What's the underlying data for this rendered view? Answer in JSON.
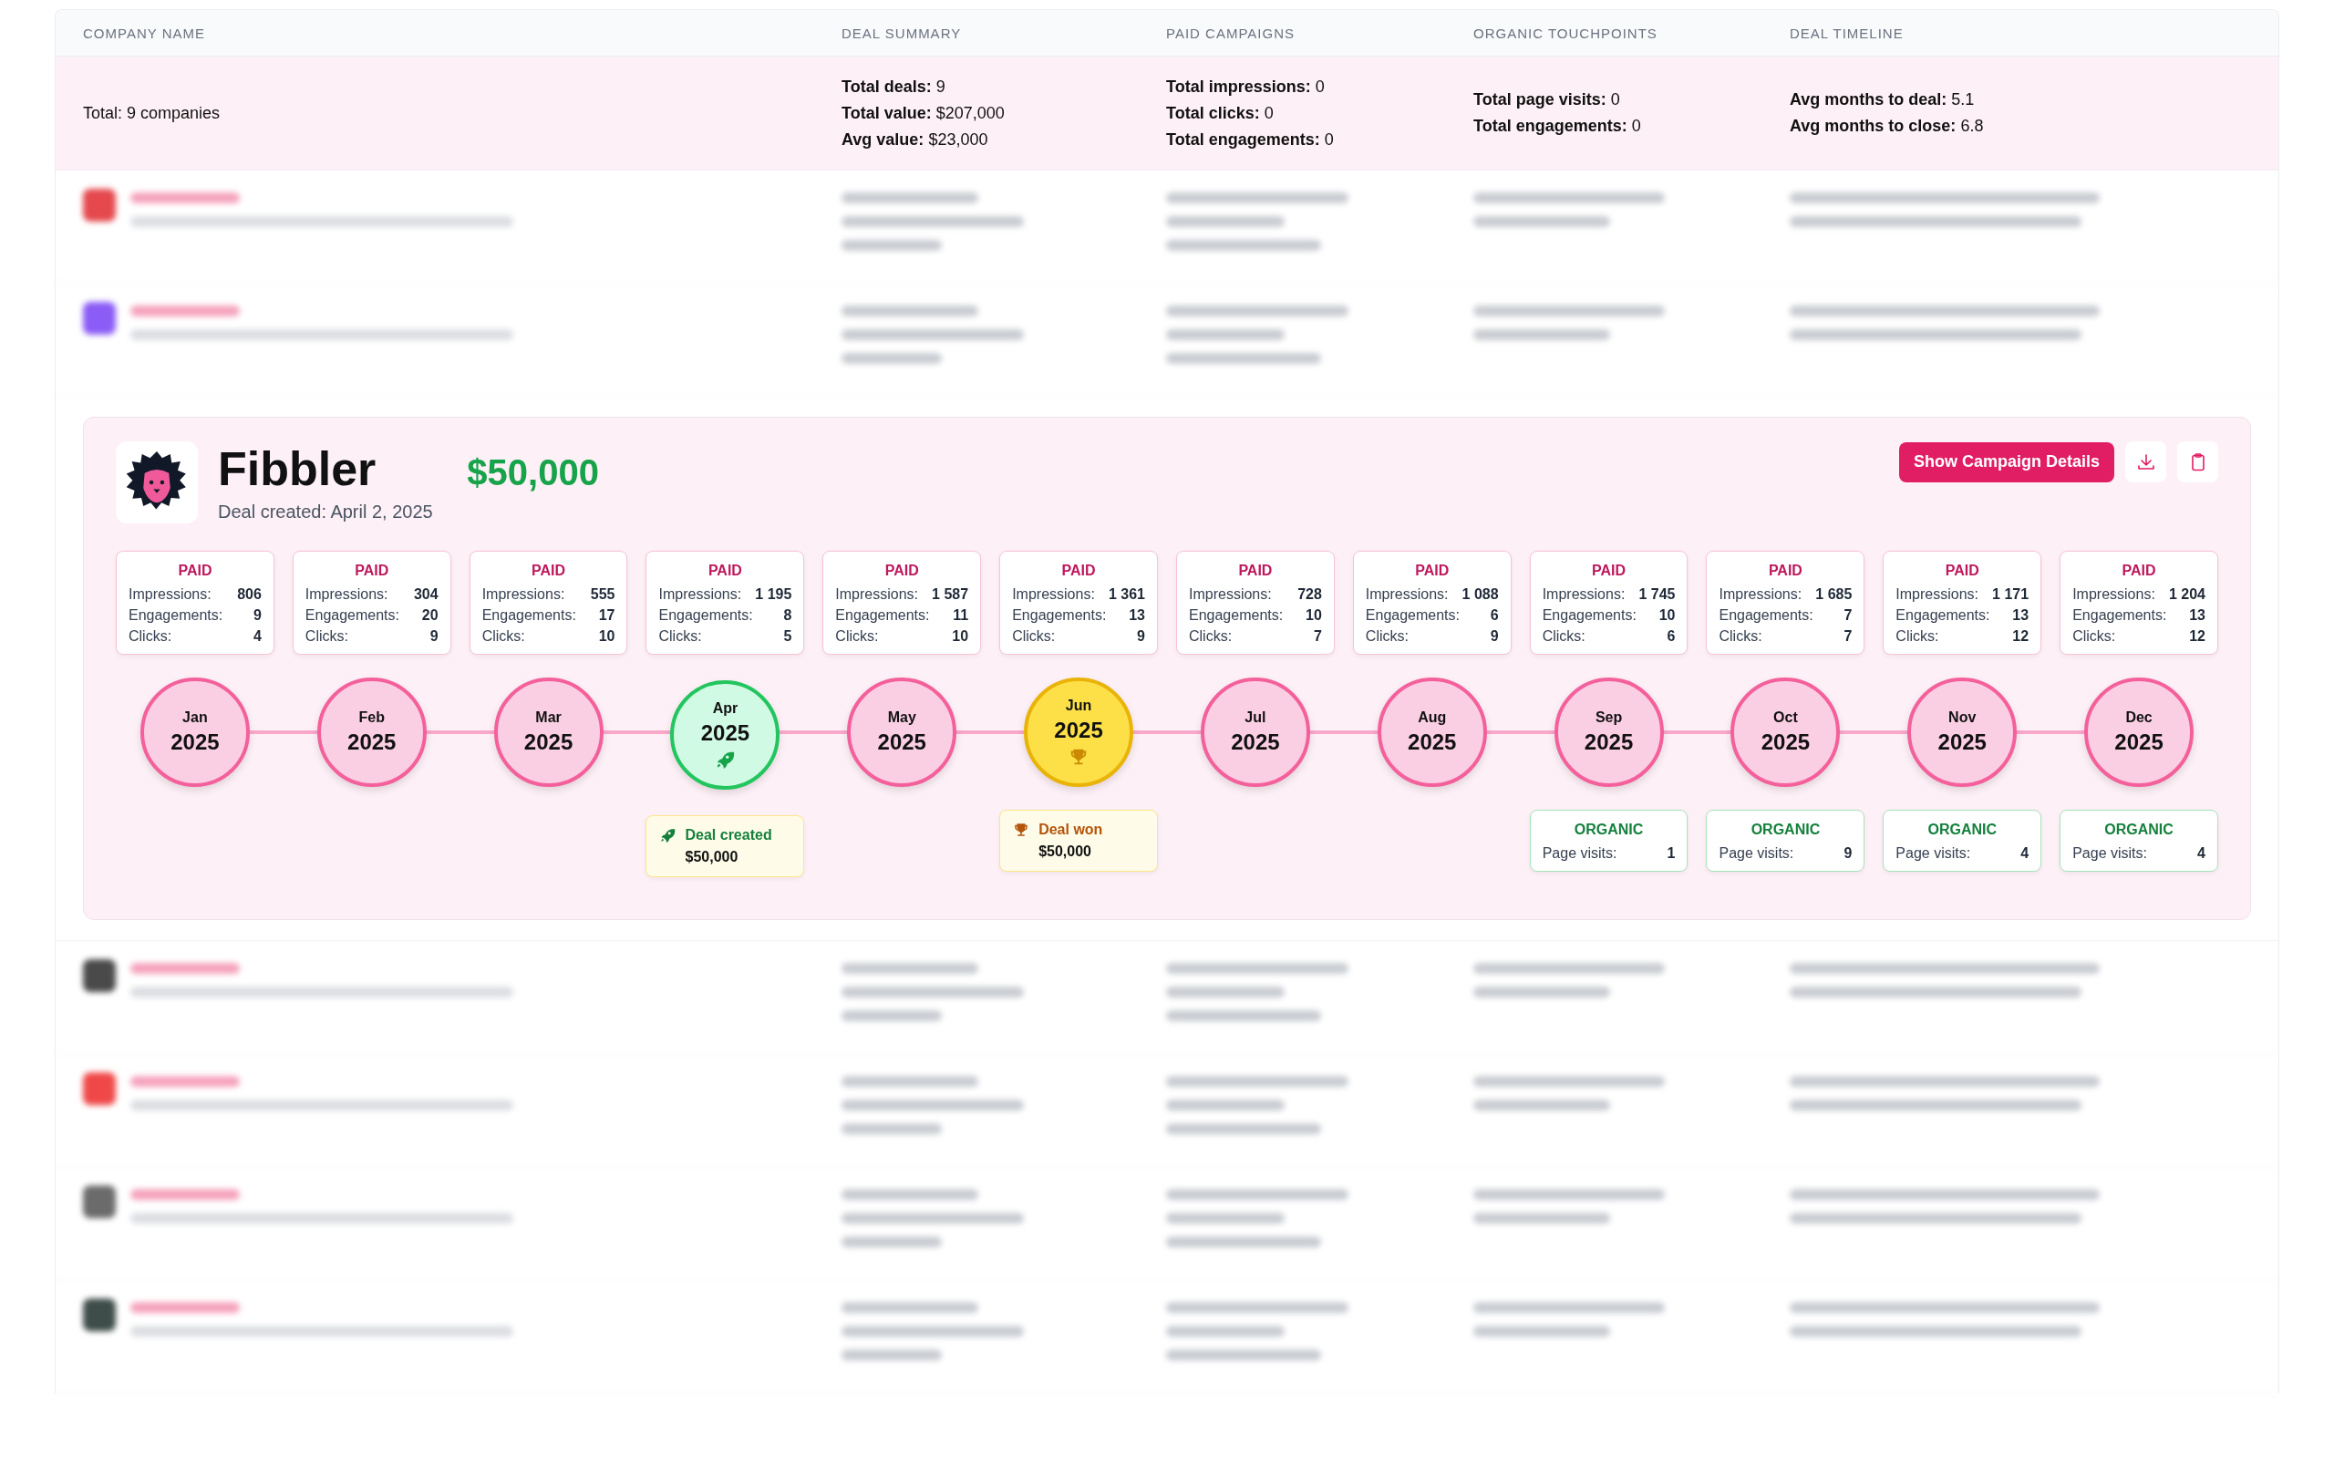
{
  "table": {
    "columns": [
      "COMPANY NAME",
      "DEAL SUMMARY",
      "PAID CAMPAIGNS",
      "ORGANIC TOUCHPOINTS",
      "DEAL TIMELINE"
    ],
    "summary": {
      "company": "Total: 9 companies",
      "cells": [
        [
          {
            "label": "Total deals:",
            "value": "9"
          },
          {
            "label": "Total value:",
            "value": "$207,000"
          },
          {
            "label": "Avg value:",
            "value": "$23,000"
          }
        ],
        [
          {
            "label": "Total impressions:",
            "value": "0"
          },
          {
            "label": "Total clicks:",
            "value": "0"
          },
          {
            "label": "Total engagements:",
            "value": "0"
          }
        ],
        [
          {
            "label": "Total page visits:",
            "value": "0"
          },
          {
            "label": "Total engagements:",
            "value": "0"
          }
        ],
        [
          {
            "label": "Avg months to deal:",
            "value": "5.1"
          },
          {
            "label": "Avg months to close:",
            "value": "6.8"
          }
        ]
      ]
    },
    "rows_before": [
      {
        "color": "#e5484d"
      },
      {
        "color": "#8b5cf6"
      }
    ],
    "rows_after": [
      {
        "color": "#4a4a4a"
      },
      {
        "color": "#f04848"
      },
      {
        "color": "#6b6b6b"
      },
      {
        "color": "#3f4d4a"
      }
    ]
  },
  "detail": {
    "company": "Fibbler",
    "value": "$50,000",
    "created": "Deal created: April 2, 2025",
    "button": "Show Campaign Details",
    "months": [
      {
        "month": "Jan",
        "year": "2025",
        "kind": "normal",
        "paid": {
          "label": "PAID",
          "rows": [
            {
              "label": "Impressions:",
              "value": "806"
            },
            {
              "label": "Engagements:",
              "value": "9"
            },
            {
              "label": "Clicks:",
              "value": "4"
            }
          ]
        }
      },
      {
        "month": "Feb",
        "year": "2025",
        "kind": "normal",
        "paid": {
          "label": "PAID",
          "rows": [
            {
              "label": "Impressions:",
              "value": "304"
            },
            {
              "label": "Engagements:",
              "value": "20"
            },
            {
              "label": "Clicks:",
              "value": "9"
            }
          ]
        }
      },
      {
        "month": "Mar",
        "year": "2025",
        "kind": "normal",
        "paid": {
          "label": "PAID",
          "rows": [
            {
              "label": "Impressions:",
              "value": "555"
            },
            {
              "label": "Engagements:",
              "value": "17"
            },
            {
              "label": "Clicks:",
              "value": "10"
            }
          ]
        }
      },
      {
        "month": "Apr",
        "year": "2025",
        "kind": "created",
        "paid": {
          "label": "PAID",
          "rows": [
            {
              "label": "Impressions:",
              "value": "1 195"
            },
            {
              "label": "Engagements:",
              "value": "8"
            },
            {
              "label": "Clicks:",
              "value": "5"
            }
          ]
        },
        "event": {
          "kind": "created",
          "label": "Deal created",
          "amount": "$50,000"
        }
      },
      {
        "month": "May",
        "year": "2025",
        "kind": "normal",
        "paid": {
          "label": "PAID",
          "rows": [
            {
              "label": "Impressions:",
              "value": "1 587"
            },
            {
              "label": "Engagements:",
              "value": "11"
            },
            {
              "label": "Clicks:",
              "value": "10"
            }
          ]
        }
      },
      {
        "month": "Jun",
        "year": "2025",
        "kind": "won",
        "paid": {
          "label": "PAID",
          "rows": [
            {
              "label": "Impressions:",
              "value": "1 361"
            },
            {
              "label": "Engagements:",
              "value": "13"
            },
            {
              "label": "Clicks:",
              "value": "9"
            }
          ]
        },
        "event": {
          "kind": "won",
          "label": "Deal won",
          "amount": "$50,000"
        }
      },
      {
        "month": "Jul",
        "year": "2025",
        "kind": "normal",
        "paid": {
          "label": "PAID",
          "rows": [
            {
              "label": "Impressions:",
              "value": "728"
            },
            {
              "label": "Engagements:",
              "value": "10"
            },
            {
              "label": "Clicks:",
              "value": "7"
            }
          ]
        }
      },
      {
        "month": "Aug",
        "year": "2025",
        "kind": "normal",
        "paid": {
          "label": "PAID",
          "rows": [
            {
              "label": "Impressions:",
              "value": "1 088"
            },
            {
              "label": "Engagements:",
              "value": "6"
            },
            {
              "label": "Clicks:",
              "value": "9"
            }
          ]
        }
      },
      {
        "month": "Sep",
        "year": "2025",
        "kind": "normal",
        "paid": {
          "label": "PAID",
          "rows": [
            {
              "label": "Impressions:",
              "value": "1 745"
            },
            {
              "label": "Engagements:",
              "value": "10"
            },
            {
              "label": "Clicks:",
              "value": "6"
            }
          ]
        },
        "organic": {
          "label": "ORGANIC",
          "rows": [
            {
              "label": "Page visits:",
              "value": "1"
            }
          ]
        }
      },
      {
        "month": "Oct",
        "year": "2025",
        "kind": "normal",
        "paid": {
          "label": "PAID",
          "rows": [
            {
              "label": "Impressions:",
              "value": "1 685"
            },
            {
              "label": "Engagements:",
              "value": "7"
            },
            {
              "label": "Clicks:",
              "value": "7"
            }
          ]
        },
        "organic": {
          "label": "ORGANIC",
          "rows": [
            {
              "label": "Page visits:",
              "value": "9"
            }
          ]
        }
      },
      {
        "month": "Nov",
        "year": "2025",
        "kind": "normal",
        "paid": {
          "label": "PAID",
          "rows": [
            {
              "label": "Impressions:",
              "value": "1 171"
            },
            {
              "label": "Engagements:",
              "value": "13"
            },
            {
              "label": "Clicks:",
              "value": "12"
            }
          ]
        },
        "organic": {
          "label": "ORGANIC",
          "rows": [
            {
              "label": "Page visits:",
              "value": "4"
            }
          ]
        }
      },
      {
        "month": "Dec",
        "year": "2025",
        "kind": "normal",
        "paid": {
          "label": "PAID",
          "rows": [
            {
              "label": "Impressions:",
              "value": "1 204"
            },
            {
              "label": "Engagements:",
              "value": "13"
            },
            {
              "label": "Clicks:",
              "value": "12"
            }
          ]
        },
        "organic": {
          "label": "ORGANIC",
          "rows": [
            {
              "label": "Page visits:",
              "value": "4"
            }
          ]
        }
      }
    ]
  }
}
